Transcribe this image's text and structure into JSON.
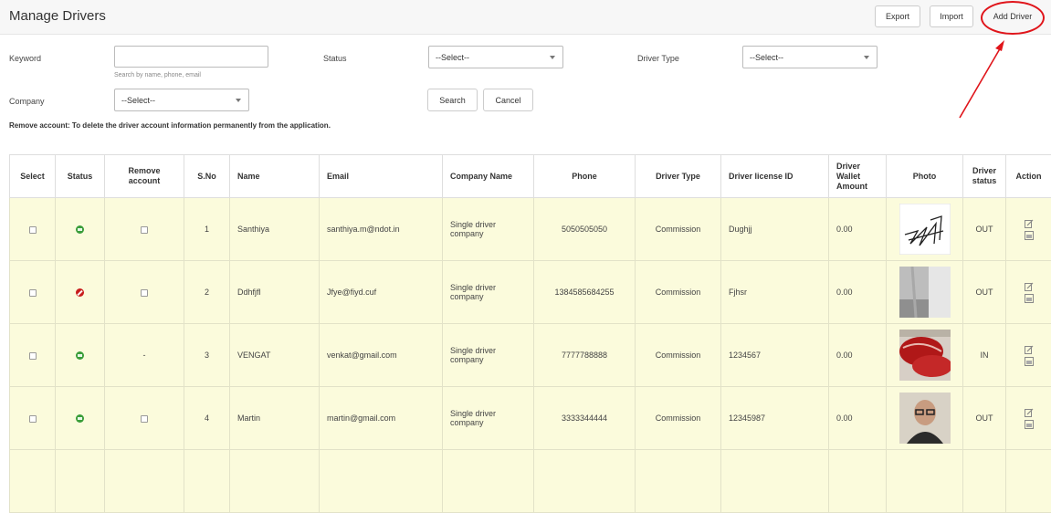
{
  "header": {
    "title": "Manage Drivers",
    "export_label": "Export",
    "import_label": "Import",
    "add_label": "Add Driver"
  },
  "filters": {
    "keyword_label": "Keyword",
    "keyword_value": "",
    "keyword_hint": "Search by name, phone, email",
    "status_label": "Status",
    "status_value": "--Select--",
    "driver_type_label": "Driver Type",
    "driver_type_value": "--Select--",
    "company_label": "Company",
    "company_value": "--Select--",
    "search_label": "Search",
    "cancel_label": "Cancel"
  },
  "note": "Remove account: To delete the driver account information permanently from the application.",
  "table": {
    "columns": [
      "Select",
      "Status",
      "Remove account",
      "S.No",
      "Name",
      "Email",
      "Company Name",
      "Phone",
      "Driver Type",
      "Driver license ID",
      "Driver Wallet Amount",
      "Photo",
      "Driver status",
      "Action"
    ],
    "rows": [
      {
        "sno": "1",
        "status": "active",
        "remove": "checkbox",
        "name": "Santhiya",
        "email": "santhiya.m@ndot.in",
        "company": "Single driver company",
        "phone": "5050505050",
        "type": "Commission",
        "license": "Dughjj",
        "wallet": "0.00",
        "photo": "signature",
        "driver_status": "OUT"
      },
      {
        "sno": "2",
        "status": "inactive",
        "remove": "checkbox",
        "name": "Ddhfjfl",
        "email": "Jfye@fiyd.cuf",
        "company": "Single driver company",
        "phone": "1384585684255",
        "type": "Commission",
        "license": "Fjhsr",
        "wallet": "0.00",
        "photo": "room",
        "driver_status": "OUT"
      },
      {
        "sno": "3",
        "status": "active",
        "remove": "-",
        "name": "VENGAT",
        "email": "venkat@gmail.com",
        "company": "Single driver company",
        "phone": "7777788888",
        "type": "Commission",
        "license": "1234567",
        "wallet": "0.00",
        "photo": "meat",
        "driver_status": "IN"
      },
      {
        "sno": "4",
        "status": "active",
        "remove": "checkbox",
        "name": "Martin",
        "email": "martin@gmail.com",
        "company": "Single driver company",
        "phone": "3333344444",
        "type": "Commission",
        "license": "12345987",
        "wallet": "0.00",
        "photo": "portrait",
        "driver_status": "OUT"
      }
    ]
  },
  "icons": {
    "status_active": "status-active-icon",
    "status_inactive": "status-inactive-icon",
    "edit": "edit-icon",
    "view": "view-icon"
  },
  "colors": {
    "row_bg": "#fbfbdc",
    "link": "#e8584d",
    "annotation": "#e0151b",
    "active": "#3a9d3a",
    "inactive": "#c81d1d"
  }
}
